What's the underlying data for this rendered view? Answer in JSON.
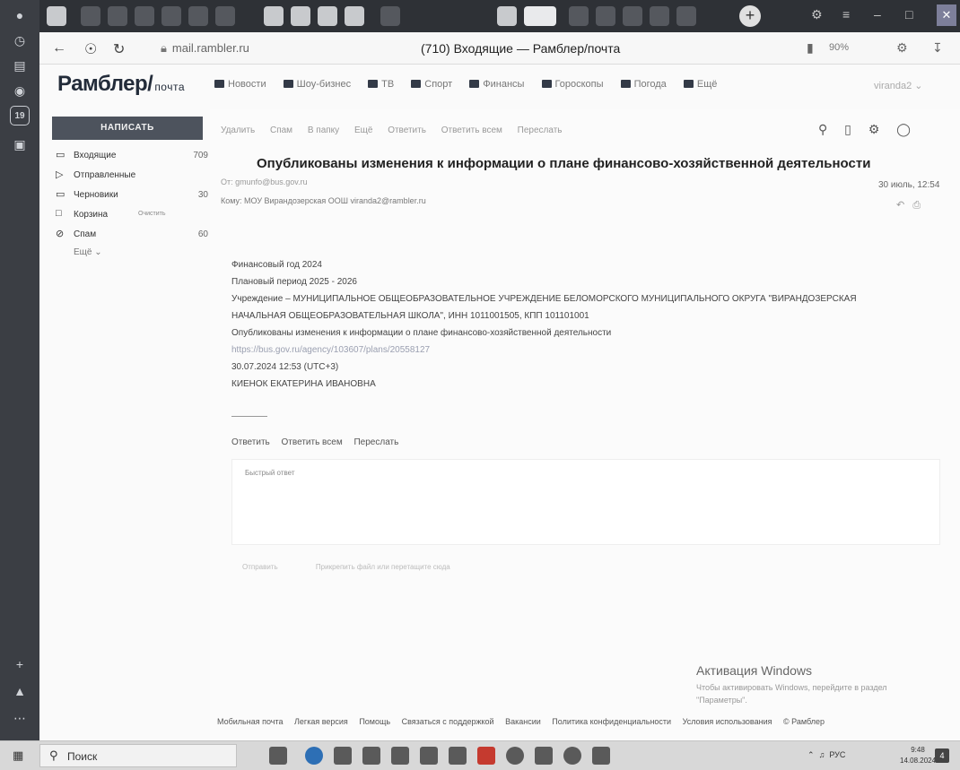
{
  "browser": {
    "rail_badge": "19",
    "url": "mail.rambler.ru",
    "title": "(710) Входящие — Рамблер/почта",
    "zoom": "90%"
  },
  "header": {
    "logo": "Рамблер/",
    "logo_sub": "почта",
    "links": [
      "Новости",
      "Шоу-бизнес",
      "ТВ",
      "Спорт",
      "Финансы",
      "Гороскопы",
      "Погода",
      "Ещё"
    ],
    "user": "viranda2 ⌄"
  },
  "sidebar": {
    "write_label": "НАПИСАТЬ",
    "folders": [
      {
        "label": "Входящие",
        "count": "709",
        "icon": "folder-icon"
      },
      {
        "label": "Отправленные",
        "count": "",
        "icon": "send-icon"
      },
      {
        "label": "Черновики",
        "count": "30",
        "icon": "draft-icon"
      },
      {
        "label": "Корзина",
        "count": "",
        "extra": "Очистить",
        "icon": "trash-icon"
      },
      {
        "label": "Спам",
        "count": "60",
        "icon": "spam-icon"
      }
    ],
    "more": "Ещё ⌄"
  },
  "toolbar": {
    "items": [
      "Удалить",
      "Спам",
      "В папку",
      "Ещё",
      "Ответить",
      "Ответить всем",
      "Переслать"
    ]
  },
  "message": {
    "subject": "Опубликованы изменения к информации о плане финансово-хозяйственной деятельности",
    "from": "От: gmunfo@bus.gov.ru",
    "to": "Кому: МОУ Вирандозерская ООШ viranda2@rambler.ru",
    "date": "30 июль, 12:54",
    "body": [
      "Финансовый год 2024",
      "Плановый период 2025 - 2026",
      "Учреждение – МУНИЦИПАЛЬНОЕ ОБЩЕОБРАЗОВАТЕЛЬНОЕ УЧРЕЖДЕНИЕ БЕЛОМОРСКОГО МУНИЦИПАЛЬНОГО ОКРУГА \"ВИРАНДОЗЕРСКАЯ",
      "НАЧАЛЬНАЯ ОБЩЕОБРАЗОВАТЕЛЬНАЯ ШКОЛА\", ИНН 1011001505, КПП 101101001",
      "Опубликованы изменения к информации о плане финансово-хозяйственной деятельности",
      "https://bus.gov.ru/agency/103607/plans/20558127",
      "30.07.2024 12:53 (UTC+3)",
      "КИЕНОК ЕКАТЕРИНА ИВАНОВНА"
    ]
  },
  "reply": {
    "links": [
      "Ответить",
      "Ответить всем",
      "Переслать"
    ],
    "placeholder": "Быстрый ответ",
    "send": "Отправить",
    "attach": "Прикрепить файл или перетащите сюда"
  },
  "watermark": {
    "title": "Активация Windows",
    "text": "Чтобы активировать Windows, перейдите в раздел \"Параметры\"."
  },
  "footer": {
    "links": [
      "Мобильная почта",
      "Легкая версия",
      "Помощь",
      "Связаться с поддержкой",
      "Вакансии",
      "Политика конфиденциальности",
      "Условия использования",
      "© Рамблер"
    ]
  },
  "taskbar": {
    "search": "Поиск",
    "lang": "РУС",
    "time": "9:48",
    "date": "14.08.2024",
    "notif_count": "4"
  }
}
